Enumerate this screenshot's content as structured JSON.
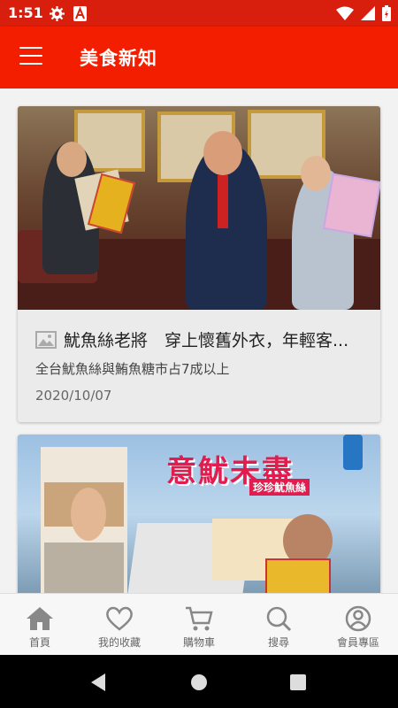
{
  "status_bar": {
    "time": "1:51",
    "icons": [
      "gear-icon",
      "font-a-icon",
      "wifi-icon",
      "signal-icon",
      "battery-charging-icon"
    ]
  },
  "app_bar": {
    "title": "美食新知",
    "menu_icon": "hamburger-menu-icon",
    "color": "#f31e00"
  },
  "articles": [
    {
      "title": "魷魚絲老將　穿上懷舊外衣，年輕客...",
      "subtitle": "全台魷魚絲與鮪魚糖市占7成以上",
      "date": "2020/10/07",
      "title_icon": "image-placeholder-icon"
    }
  ],
  "magazine_card": {
    "headline": "意魷未盡",
    "tagline": "珍珍魷魚絲"
  },
  "bottom_nav": {
    "items": [
      {
        "label": "首頁",
        "icon": "home-icon",
        "active": true
      },
      {
        "label": "我的收藏",
        "icon": "heart-icon"
      },
      {
        "label": "購物車",
        "icon": "cart-icon"
      },
      {
        "label": "搜尋",
        "icon": "search-icon"
      },
      {
        "label": "會員專區",
        "icon": "user-icon"
      }
    ]
  },
  "system_nav": {
    "icons": [
      "back-icon",
      "home-circle-icon",
      "recents-icon"
    ]
  }
}
